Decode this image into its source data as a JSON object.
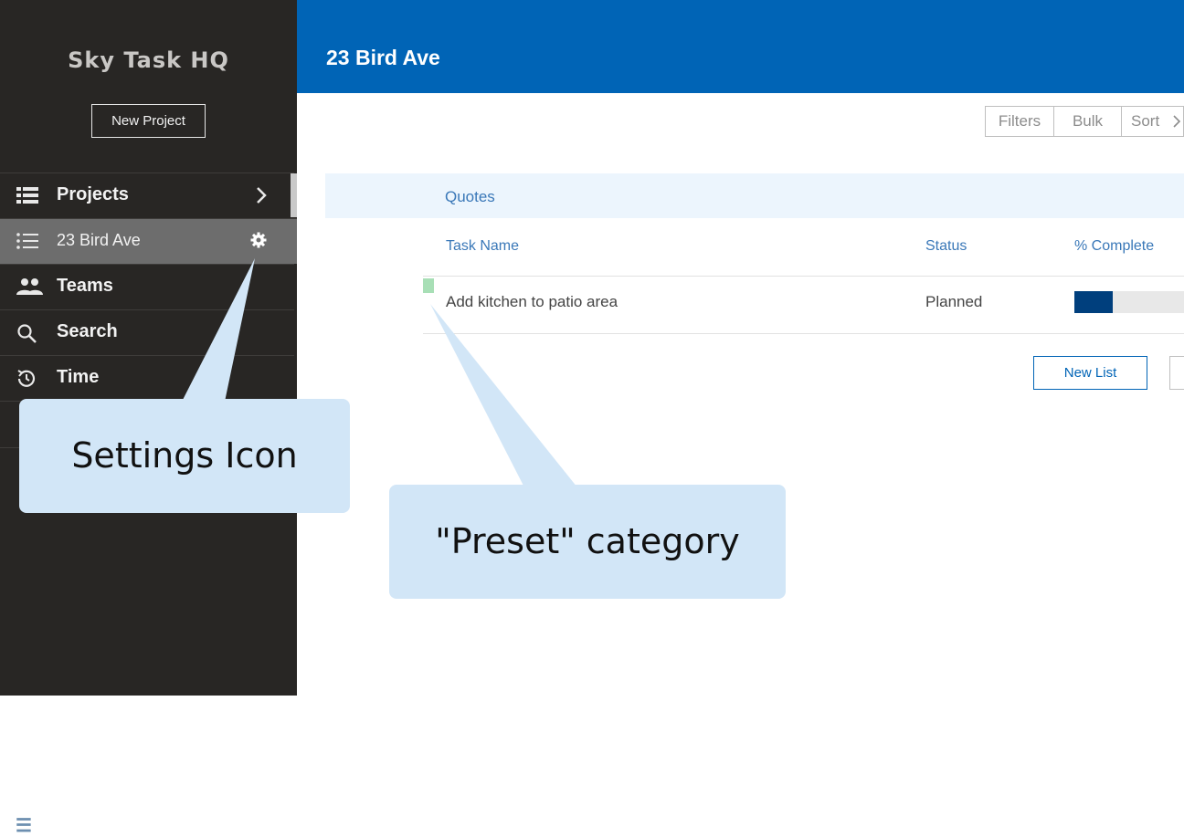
{
  "app": {
    "brand": "Sky Task HQ",
    "new_project_label": "New Project"
  },
  "sidebar": {
    "items": [
      {
        "label": "Projects",
        "icon": "list-grid-icon"
      },
      {
        "label": "23 Bird Ave",
        "icon": "list-icon",
        "active": true
      },
      {
        "label": "Teams",
        "icon": "people-icon"
      },
      {
        "label": "Search",
        "icon": "magnifier-icon"
      },
      {
        "label": "Time",
        "icon": "clock-history-icon"
      }
    ]
  },
  "header": {
    "title": "23 Bird Ave"
  },
  "toolbar": {
    "filters": "Filters",
    "bulk": "Bulk",
    "sort": "Sort"
  },
  "list": {
    "group": "Quotes",
    "columns": {
      "task": "Task Name",
      "status": "Status",
      "complete": "% Complete"
    },
    "rows": [
      {
        "name": "Add kitchen to patio area",
        "status": "Planned",
        "percent": 35,
        "category_color": "#a8dfb6"
      }
    ],
    "new_list_label": "New List"
  },
  "callouts": {
    "settings": "Settings Icon",
    "preset": "\"Preset\" category"
  },
  "colors": {
    "sidebar": "#282624",
    "header": "#0064b6",
    "accent": "#3a78b8",
    "progress": "#003f7d",
    "callout": "#d2e6f7"
  }
}
